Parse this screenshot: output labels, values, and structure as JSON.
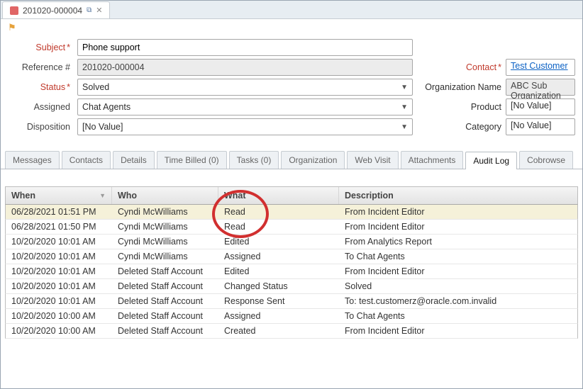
{
  "window": {
    "tab_title": "201020-000004"
  },
  "form": {
    "labels": {
      "subject": "Subject",
      "reference": "Reference #",
      "status": "Status",
      "assigned": "Assigned",
      "disposition": "Disposition",
      "contact": "Contact",
      "org": "Organization Name",
      "product": "Product",
      "category": "Category"
    },
    "values": {
      "subject": "Phone support",
      "reference": "201020-000004",
      "status": "Solved",
      "assigned": "Chat Agents",
      "disposition": "[No Value]",
      "contact": "Test Customer",
      "org": "ABC Sub Organization",
      "product": "[No Value]",
      "category": "[No Value]"
    }
  },
  "tabs": [
    {
      "label": "Messages",
      "active": false
    },
    {
      "label": "Contacts",
      "active": false
    },
    {
      "label": "Details",
      "active": false
    },
    {
      "label": "Time Billed (0)",
      "active": false
    },
    {
      "label": "Tasks (0)",
      "active": false
    },
    {
      "label": "Organization",
      "active": false
    },
    {
      "label": "Web Visit",
      "active": false
    },
    {
      "label": "Attachments",
      "active": false
    },
    {
      "label": "Audit Log",
      "active": true
    },
    {
      "label": "Cobrowse",
      "active": false
    }
  ],
  "grid": {
    "headers": {
      "when": "When",
      "who": "Who",
      "what": "What",
      "desc": "Description"
    },
    "rows": [
      {
        "when": "06/28/2021 01:51 PM",
        "who": "Cyndi McWilliams",
        "what": "Read",
        "desc": "From Incident Editor"
      },
      {
        "when": "06/28/2021 01:50 PM",
        "who": "Cyndi McWilliams",
        "what": "Read",
        "desc": "From Incident Editor"
      },
      {
        "when": "10/20/2020 10:01 AM",
        "who": "Cyndi McWilliams",
        "what": "Edited",
        "desc": "From Analytics Report"
      },
      {
        "when": "10/20/2020 10:01 AM",
        "who": "Cyndi McWilliams",
        "what": "Assigned",
        "desc": "To Chat Agents"
      },
      {
        "when": "10/20/2020 10:01 AM",
        "who": "Deleted Staff Account",
        "what": "Edited",
        "desc": "From Incident Editor"
      },
      {
        "when": "10/20/2020 10:01 AM",
        "who": "Deleted Staff Account",
        "what": "Changed Status",
        "desc": "Solved"
      },
      {
        "when": "10/20/2020 10:01 AM",
        "who": "Deleted Staff Account",
        "what": "Response Sent",
        "desc": "To: test.customerz@oracle.com.invalid"
      },
      {
        "when": "10/20/2020 10:00 AM",
        "who": "Deleted Staff Account",
        "what": "Assigned",
        "desc": "To Chat Agents"
      },
      {
        "when": "10/20/2020 10:00 AM",
        "who": "Deleted Staff Account",
        "what": "Created",
        "desc": "From Incident Editor"
      }
    ]
  }
}
